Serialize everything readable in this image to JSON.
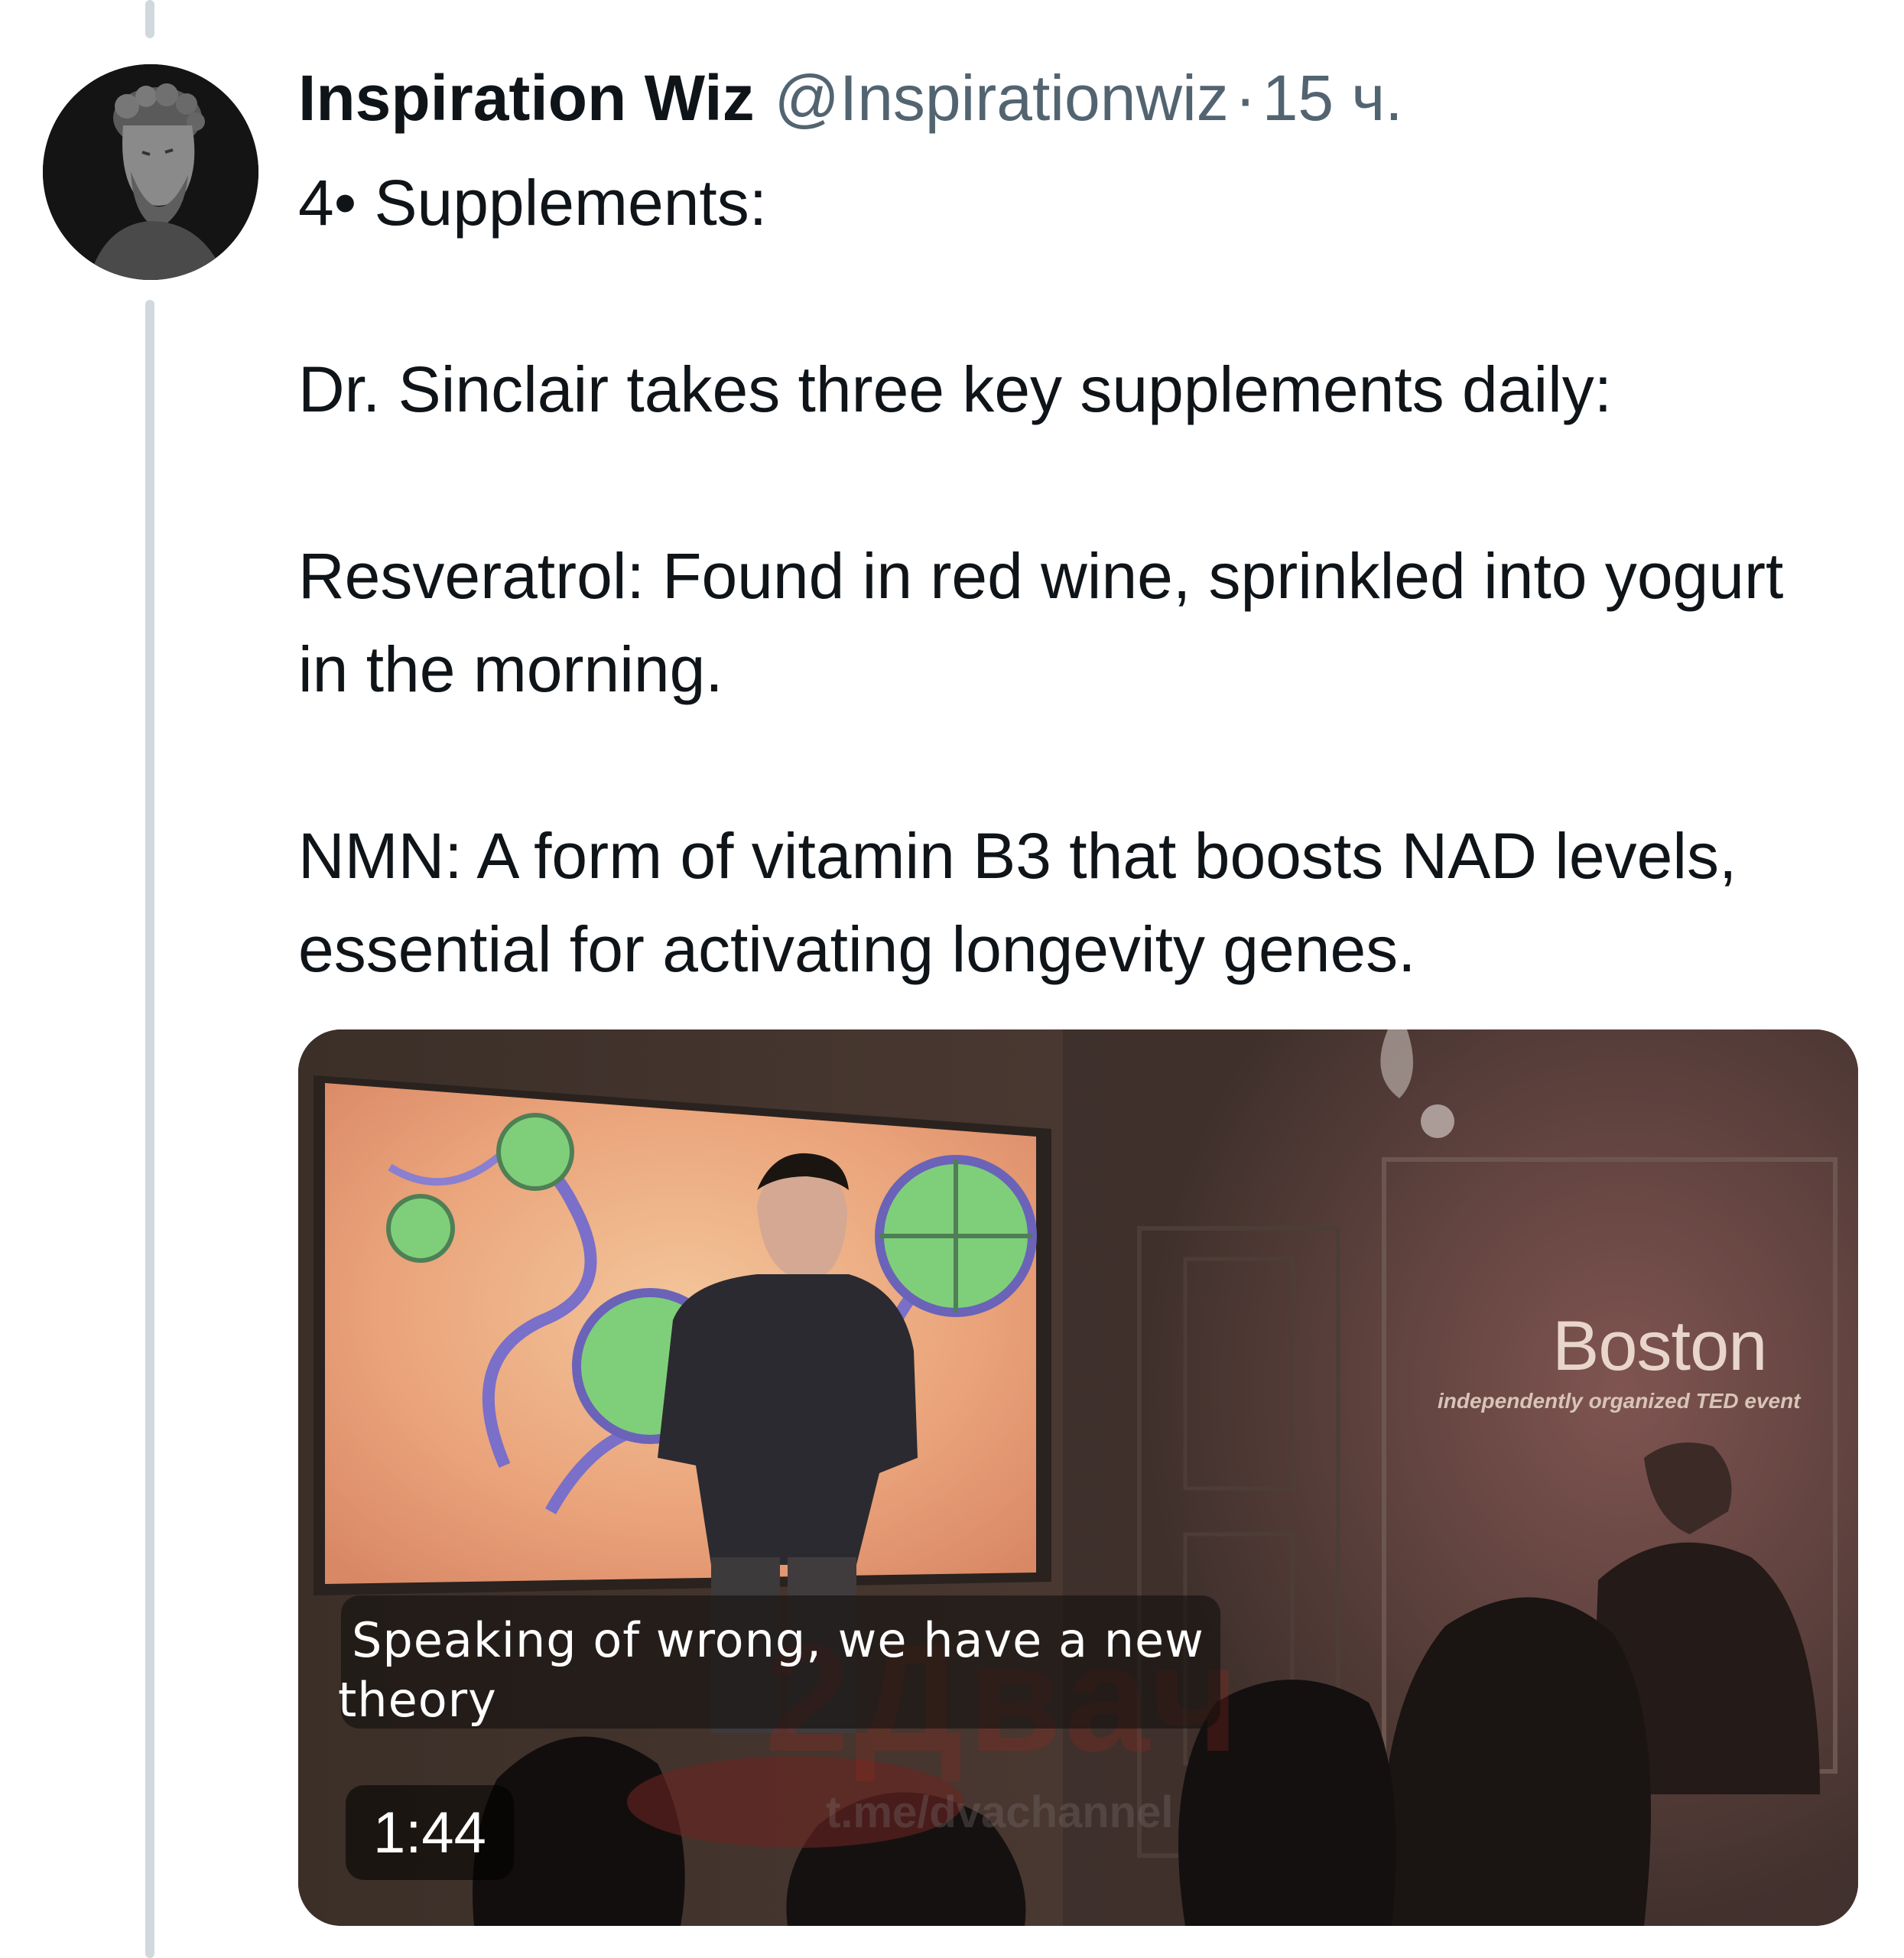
{
  "tweet": {
    "display_name": "Inspiration Wiz",
    "handle": "@Inspirationwiz",
    "separator": "·",
    "time": "15 ч.",
    "paragraphs": [
      "4• Supplements:",
      "Dr. Sinclair takes three key supplements daily:",
      "Resveratrol: Found in red wine, sprinkled into yogurt in the morning.",
      "NMN: A form of vitamin B3 that boosts NAD levels, essential for activating longevity genes."
    ]
  },
  "avatar": {
    "icon": "bust-statue-avatar"
  },
  "media": {
    "type": "video",
    "caption_line1": "Speaking of wrong, we have a new",
    "caption_line2": "theory",
    "duration": "1:44",
    "backdrop_title": "Boston",
    "backdrop_subtitle": "independently organized TED event",
    "watermark": "2Двач",
    "watermark_url": "t.me/dvachannel"
  },
  "colors": {
    "text_primary": "#0f1419",
    "text_secondary": "#536471",
    "thread_line": "#cfd9de"
  }
}
